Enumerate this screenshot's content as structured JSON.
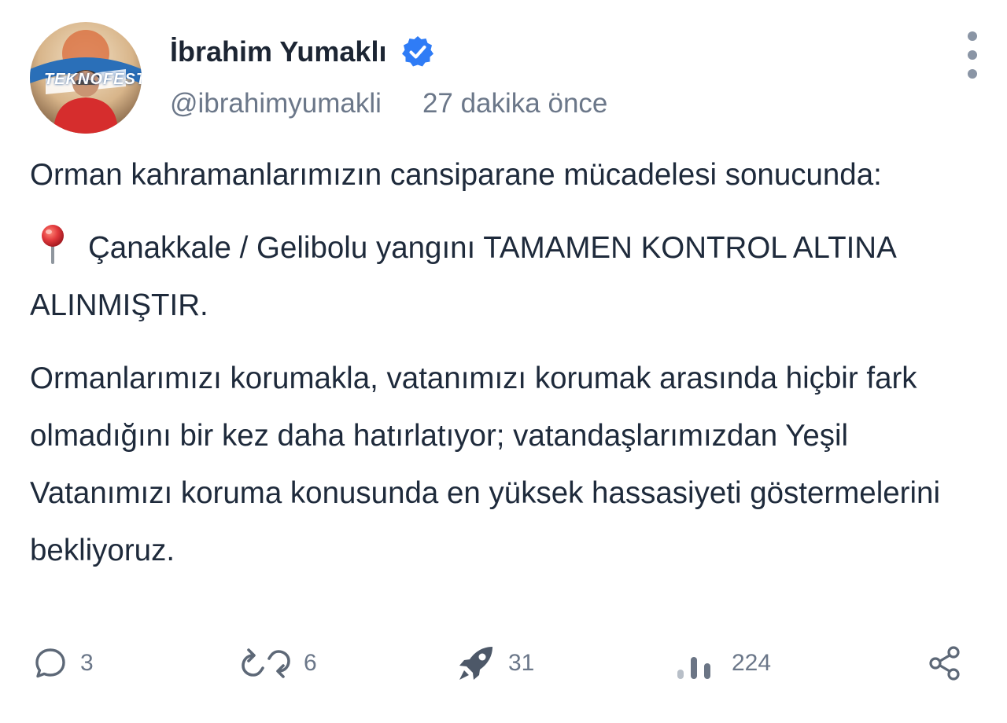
{
  "post": {
    "author": {
      "display_name": "İbrahim Yumaklı",
      "handle": "@ibrahimyumakli",
      "verified": true,
      "avatar_badge_text": "TEKNOFEST"
    },
    "timestamp": "27 dakika önce",
    "paragraphs": [
      {
        "text": "Orman kahramanlarımızın cansiparane mücadelesi sonucunda:"
      },
      {
        "icon": "round-pushpin-icon",
        "text": "Çanakkale / Gelibolu yangını TAMAMEN KONTROL ALTINA ALINMIŞTIR."
      },
      {
        "text": "Ormanlarımızı korumakla, vatanımızı korumak arasında hiçbir fark olmadığını bir kez daha hatırlatıyor; vatandaşlarımızdan Yeşil Vatanımızı koruma konusunda en yüksek hassasiyeti göstermelerini bekliyoruz."
      }
    ],
    "actions": {
      "replies": "3",
      "reposts": "6",
      "boosts": "31",
      "views": "224"
    },
    "colors": {
      "verified_badge": "#2f7cf6",
      "text_primary": "#1e2a3b",
      "text_secondary": "#6b7789",
      "pin_red": "#e2393c"
    }
  }
}
